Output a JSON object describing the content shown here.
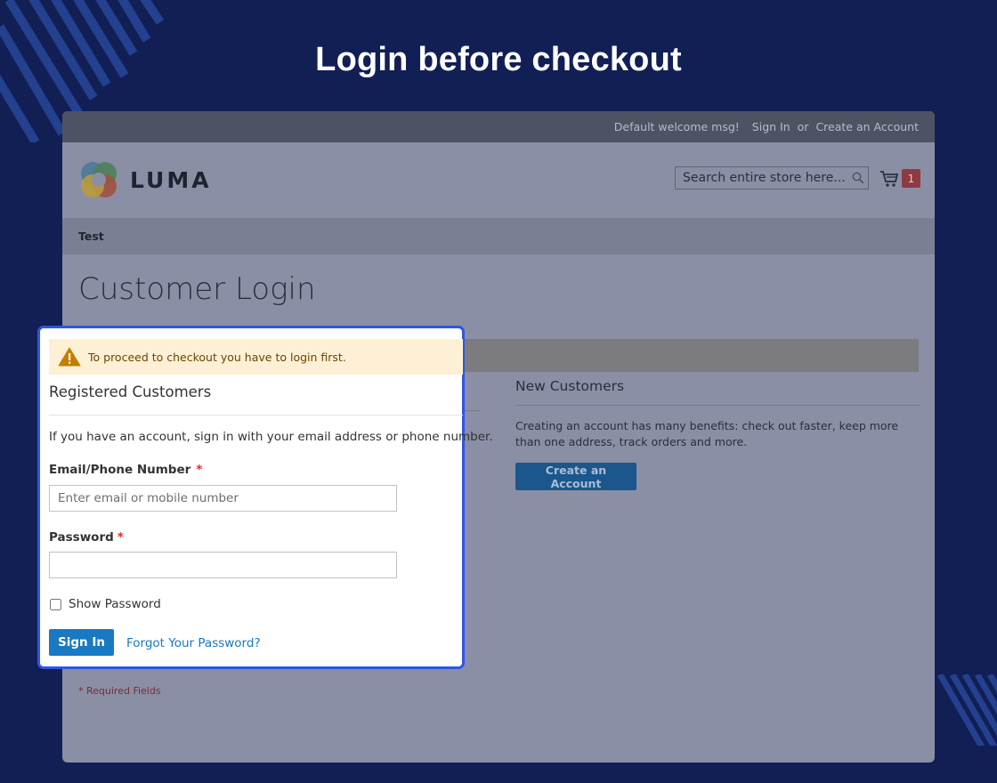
{
  "headline": "Login before checkout",
  "topbar": {
    "welcome": "Default welcome msg!",
    "sign_in": "Sign In",
    "or": "or",
    "create_account": "Create an Account"
  },
  "header": {
    "logo_text": "LUMA",
    "search_placeholder": "Search entire store here...",
    "cart_count": "1"
  },
  "nav": {
    "item": "Test"
  },
  "page_title": "Customer Login",
  "alert": {
    "text": "To proceed to checkout you have to login first."
  },
  "registered": {
    "title": "Registered Customers",
    "intro": "If you have an account, sign in with your email address or phone number.",
    "email_label": "Email/Phone Number",
    "email_placeholder": "Enter email or mobile number",
    "password_label": "Password",
    "required_mark": "*",
    "show_password": "Show Password",
    "sign_in_button": "Sign In",
    "forgot_link": "Forgot Your Password?"
  },
  "new_customers": {
    "title": "New Customers",
    "text": "Creating an account has many benefits: check out faster, keep more than one address, track orders and more.",
    "button": "Create an Account"
  },
  "required_fields": "* Required Fields",
  "colors": {
    "background": "#121f55",
    "accent": "#1979c3",
    "highlight_border": "#2d55e6",
    "alert_bg": "#fdf0d5",
    "required": "#e02b27"
  }
}
